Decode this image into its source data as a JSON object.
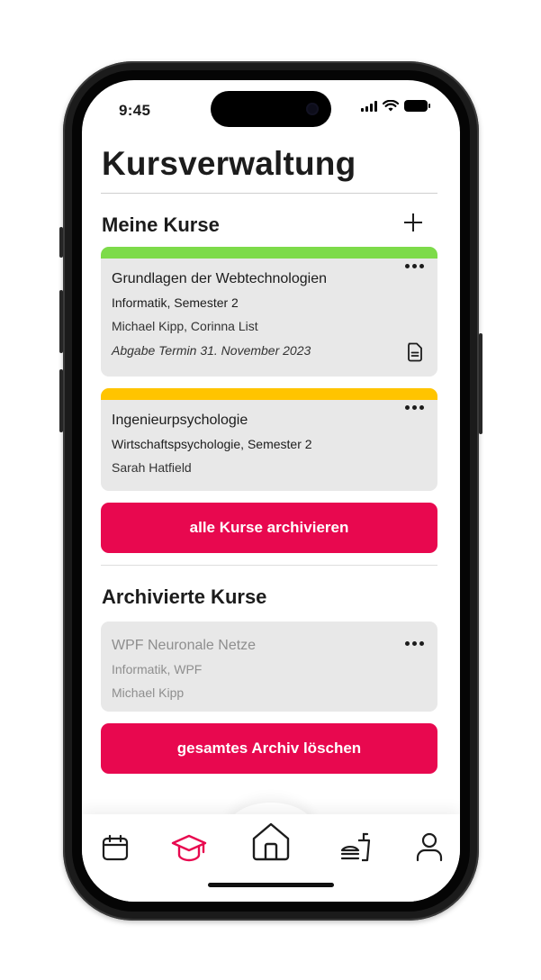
{
  "status_bar": {
    "time": "9:45"
  },
  "page": {
    "title": "Kursverwaltung"
  },
  "my_courses": {
    "heading": "Meine Kurse",
    "courses": [
      {
        "title": "Grundlagen der Webtechnologien",
        "program": "Informatik, Semester 2",
        "lecturers": "Michael Kipp, Corinna List",
        "deadline": "Abgabe Termin 31. November 2023",
        "accent": "#7ddb4a"
      },
      {
        "title": "Ingenieurpsychologie",
        "program": "Wirtschaftspsychologie, Semester 2",
        "lecturers": "Sarah Hatfield",
        "accent": "#ffc400"
      }
    ],
    "archive_all_label": "alle Kurse archivieren"
  },
  "archived_courses": {
    "heading": "Archivierte Kurse",
    "courses": [
      {
        "title": "WPF Neuronale Netze",
        "program": "Informatik, WPF",
        "lecturers": "Michael Kipp"
      }
    ],
    "delete_archive_label": "gesamtes Archiv löschen"
  },
  "nav": {
    "items": [
      {
        "icon": "calendar-icon",
        "active": false
      },
      {
        "icon": "graduation-cap-icon",
        "active": true
      },
      {
        "icon": "home-icon",
        "active": false
      },
      {
        "icon": "food-icon",
        "active": false
      },
      {
        "icon": "user-icon",
        "active": false
      }
    ]
  },
  "colors": {
    "brand": "#e8084f",
    "active_icon": "#e8084f",
    "card_bg": "#e8e8e8"
  }
}
